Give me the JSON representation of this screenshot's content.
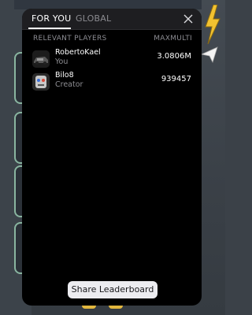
{
  "tabs": [
    {
      "label": "FOR YOU"
    },
    {
      "label": "GLOBAL"
    }
  ],
  "columns": {
    "left": "RELEVANT PLAYERS",
    "right": "MAXMULTI"
  },
  "players": [
    {
      "name": "RobertoKael",
      "role": "You",
      "score": "3.0806M",
      "avatar_icon": "red-car-avatar"
    },
    {
      "name": "Bilo8",
      "role": "Creator",
      "score": "939457",
      "avatar_icon": "robot-avatar"
    }
  ],
  "share_button": {
    "label": "Share Leaderboard"
  },
  "colors": {
    "panel_bg": "#000000",
    "tab_bar_bg": "#1e1e21",
    "accent_border": "#89b5a0",
    "bolt": "#f2c230"
  }
}
